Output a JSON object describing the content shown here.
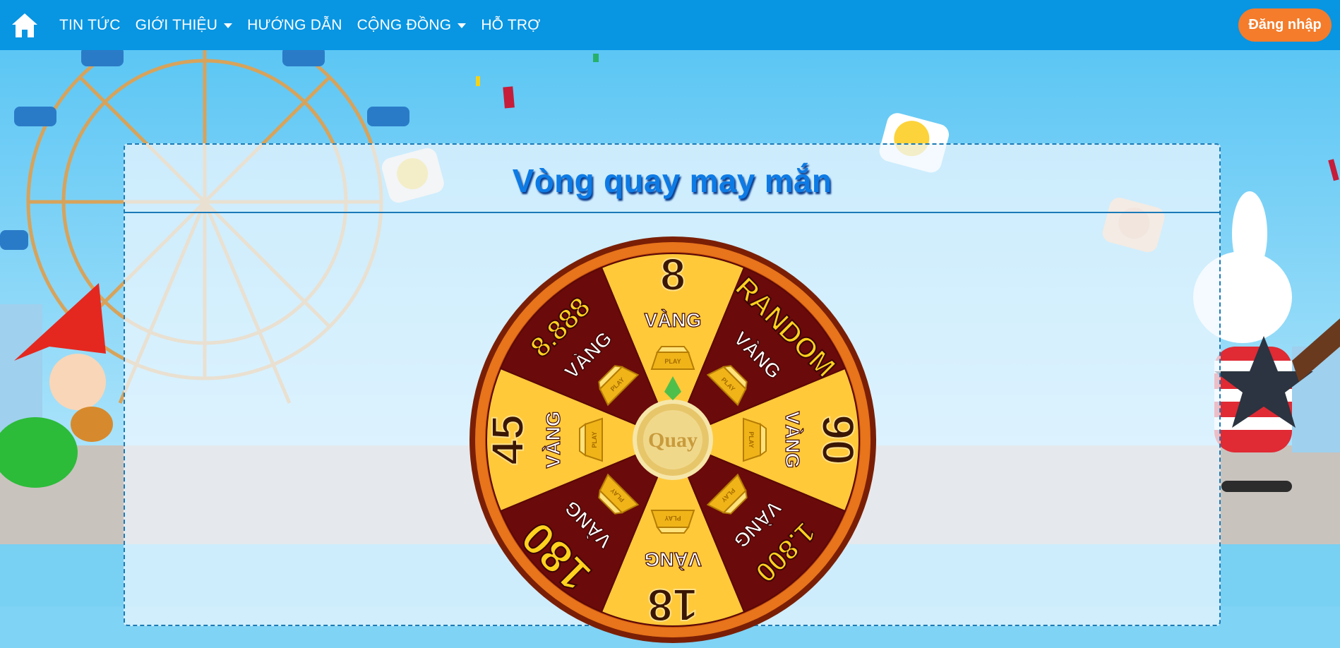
{
  "nav": {
    "items": [
      {
        "label": "TIN TỨC",
        "has_dropdown": false
      },
      {
        "label": "GIỚI THIỆU",
        "has_dropdown": true
      },
      {
        "label": "HƯỚNG DẪN",
        "has_dropdown": false
      },
      {
        "label": "CỘNG ĐỒNG",
        "has_dropdown": true
      },
      {
        "label": "HỖ TRỢ",
        "has_dropdown": false
      }
    ],
    "login_label": "Đăng nhập",
    "home_icon": "home-icon"
  },
  "panel": {
    "title": "Vòng quay may mắn"
  },
  "wheel": {
    "center_label": "Quay",
    "bar_stamp": "PLAY",
    "segments": [
      {
        "amount": "8",
        "unit": "VÀNG"
      },
      {
        "amount": "RANDOM",
        "unit": "VÀNG"
      },
      {
        "amount": "90",
        "unit": "VÀNG"
      },
      {
        "amount": "1.800",
        "unit": "VÀNG"
      },
      {
        "amount": "18",
        "unit": "VÀNG"
      },
      {
        "amount": "180",
        "unit": "VÀNG"
      },
      {
        "amount": "45",
        "unit": "VÀNG"
      },
      {
        "amount": "8.888",
        "unit": "VÀNG"
      }
    ]
  },
  "colors": {
    "nav_bg": "#0895e2",
    "login_bg": "#f47c2b",
    "title": "#0d7be5",
    "segment_yellow": "#ffc93a",
    "segment_maroon": "#6b0a0a"
  }
}
